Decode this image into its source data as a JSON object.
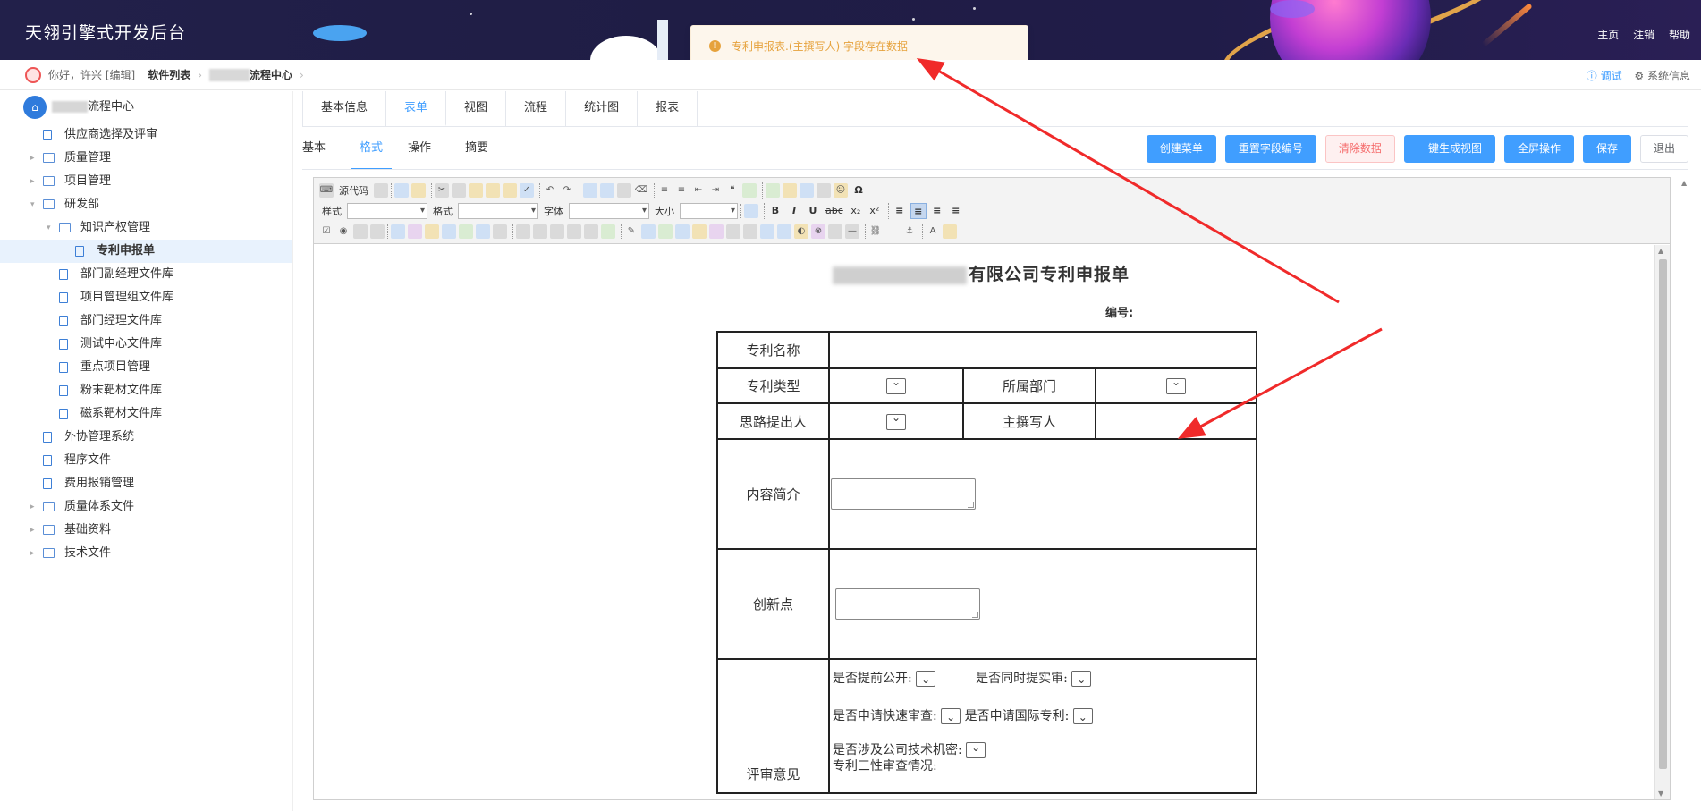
{
  "header": {
    "title": "天翎引擎式开发后台",
    "links": [
      "主页",
      "注销",
      "帮助"
    ]
  },
  "toast": {
    "icon": "warning-icon",
    "message": "专利申报表.(主撰写人) 字段存在数据"
  },
  "breadcrumb": {
    "greeting": "你好，许兴 [编辑]",
    "items": [
      "软件列表",
      "流程中心"
    ],
    "right": {
      "debug": "调试",
      "system": "系统信息"
    }
  },
  "sidebar": {
    "root_label": "流程中心",
    "items": [
      {
        "label": "供应商选择及评审",
        "type": "doc",
        "level": 1
      },
      {
        "label": "质量管理",
        "type": "folder",
        "level": 1,
        "expanded": false
      },
      {
        "label": "项目管理",
        "type": "folder",
        "level": 1,
        "expanded": false
      },
      {
        "label": "研发部",
        "type": "folder",
        "level": 1,
        "expanded": true
      },
      {
        "label": "知识产权管理",
        "type": "folder",
        "level": 2,
        "expanded": true
      },
      {
        "label": "专利申报单",
        "type": "doc",
        "level": 3,
        "active": true
      },
      {
        "label": "部门副经理文件库",
        "type": "doc",
        "level": 2
      },
      {
        "label": "项目管理组文件库",
        "type": "doc",
        "level": 2
      },
      {
        "label": "部门经理文件库",
        "type": "doc",
        "level": 2
      },
      {
        "label": "测试中心文件库",
        "type": "doc",
        "level": 2
      },
      {
        "label": "重点项目管理",
        "type": "doc",
        "level": 2
      },
      {
        "label": "粉末靶材文件库",
        "type": "doc",
        "level": 2
      },
      {
        "label": "磁系靶材文件库",
        "type": "doc",
        "level": 2
      },
      {
        "label": "外协管理系统",
        "type": "doc",
        "level": 1
      },
      {
        "label": "程序文件",
        "type": "doc",
        "level": 1
      },
      {
        "label": "费用报销管理",
        "type": "doc",
        "level": 1
      },
      {
        "label": "质量体系文件",
        "type": "folder",
        "level": 1,
        "expanded": false
      },
      {
        "label": "基础资料",
        "type": "folder",
        "level": 1,
        "expanded": false
      },
      {
        "label": "技术文件",
        "type": "folder",
        "level": 1,
        "expanded": false
      }
    ]
  },
  "tabs": [
    "基本信息",
    "表单",
    "视图",
    "流程",
    "统计图",
    "报表"
  ],
  "subtabs": [
    "基本",
    "格式",
    "操作",
    "摘要"
  ],
  "actions": [
    "创建菜单",
    "重置字段编号",
    "清除数据",
    "一键生成视图",
    "全屏操作",
    "保存",
    "退出"
  ],
  "toolbar": {
    "source_label": "源代码",
    "style_label": "样式",
    "format_label": "格式",
    "font_label": "字体",
    "size_label": "大小",
    "bold": "B",
    "italic": "I",
    "underline": "U",
    "strike": "abc",
    "omega": "Ω"
  },
  "form": {
    "title_suffix": "有限公司专利申报单",
    "serial_label": "编号:",
    "rows": {
      "patent_name": "专利名称",
      "patent_type": "专利类型",
      "department": "所属部门",
      "idea_proposer": "思路提出人",
      "main_writer": "主撰写人",
      "summary": "内容简介",
      "innovation": "创新点",
      "review": "评审意见"
    },
    "review_items": [
      "是否提前公开:",
      "是否同时提实审:",
      "是否申请快速审查:",
      "是否申请国际专利:",
      "是否涉及公司技术机密:",
      "专利三性审查情况:"
    ]
  },
  "colors": {
    "accent": "#409eff",
    "warning": "#e6a23c",
    "danger": "#f56c6c",
    "header_bg": "#201d47",
    "annotation": "#f02a2a"
  }
}
